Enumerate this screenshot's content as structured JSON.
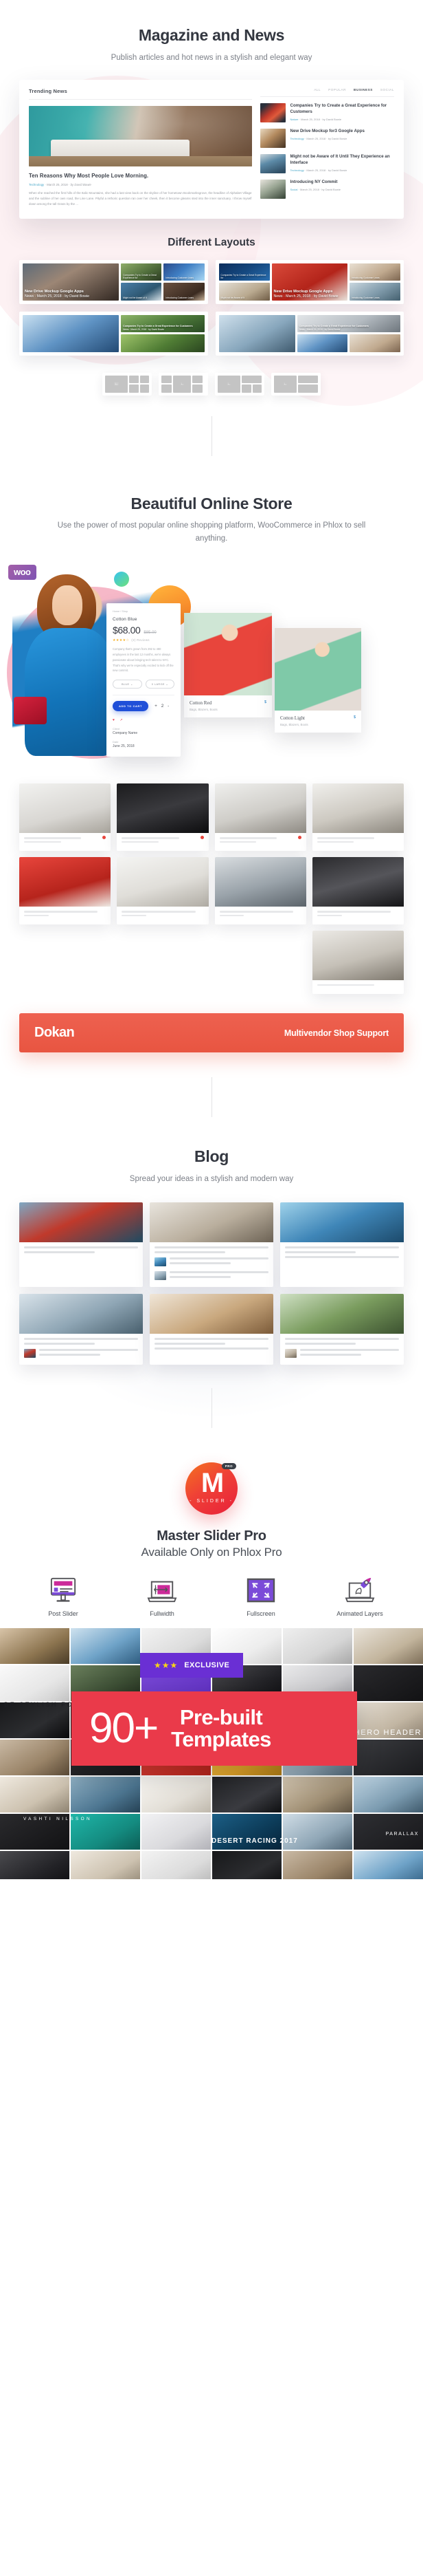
{
  "magazine": {
    "title": "Magazine and News",
    "subtitle": "Publish articles and hot news in a stylish and elegant way",
    "mockup": {
      "section_heading": "Trending News",
      "tabs": [
        "ALL",
        "POPULAR",
        "BUSINESS",
        "SOCIAL"
      ],
      "active_tab": "BUSINESS",
      "feature": {
        "title": "Ten Reasons Why Most People Love Morning.",
        "category": "Technology",
        "date": "March 25, 2018",
        "author": "by David Bowie",
        "excerpt": "When she reached the first hills of the Italic Mountains, she had a last view back on the skyline of her hometown Bookmarksgrove, the headline of Alphabet Village and the subline of her own road, the Line Lane. Pityful a rethoric question ran over her cheek, then it become gleams sted into the inner sanctuary. I throw myself down among the tall Grass by the ..."
      },
      "sidebar_items": [
        {
          "title": "Companies Try to Create a Great Experience for Customers",
          "category": "Nature",
          "date": "March 25, 2018",
          "author": "by David Bowie"
        },
        {
          "title": "New Drive Mockup for3 Google Apps",
          "category": "Technology",
          "date": "March 25, 2018",
          "author": "by David Bowie"
        },
        {
          "title": "Might not be Aware of It Until They Experience an Interface",
          "category": "Technology",
          "date": "March 25, 2018",
          "author": "by David Bowie"
        },
        {
          "title": "Introducing NY Commit",
          "category": "Social",
          "date": "March 25, 2018",
          "author": "by David Bowie"
        }
      ]
    },
    "layouts_title": "Different Layouts",
    "layout_cards": [
      {
        "main_title": "New Drive Mockup Google Apps",
        "main_meta": "News · March 25, 2018 · by David Bowie",
        "cells": [
          "Companies Try to Create a Great Experience for",
          "Introducing Customer Lears",
          "Might not be Aware of It",
          "Introducing Customer Lears"
        ]
      },
      {
        "main_title": "New Drive Mockup Google Apps",
        "main_meta": "News · March 25, 2018 · by David Bowie",
        "cells": [
          "Companies Try to Create a Great Experience for",
          "Introducing Customer Lears",
          "Might not be Aware of It",
          "Introducing Customer Lears"
        ]
      },
      {
        "main_title": "Companies Try to Create a Great Experience for Customers",
        "main_meta": "News · March 25, 2018 · by David Bowie",
        "cells": [
          "Companies Try to Create a Great Experience for",
          "Introducing Customer Lears",
          "Might not be Aware of It",
          "Introducing Customer Lears"
        ]
      },
      {
        "main_title": "Companies Try to Create a Great Experience for Customers",
        "main_meta": "News · March 25, 2018 · by David Bowie",
        "cells": [
          "Companies Try to Create a Great Experience for",
          "Introducing Customer Lears",
          "Might not be Aware of It",
          "Introducing Customer Lears"
        ]
      }
    ],
    "wireframe_count": 4
  },
  "store": {
    "title": "Beautiful Online Store",
    "subtitle": "Use the power of most popular online shopping platform, WooCommerce in Phlox to sell anything.",
    "woo_logo": "woo",
    "product": {
      "breadcrumb": "Home / Shop",
      "name": "Cotton Blue",
      "price": "$68.00",
      "old_price": "$85.00",
      "stars": "★★★★☆",
      "reviews": "(2) Reviews",
      "description": "Company that's grown from 292 to 480 employees in the last 12 months, we're always passionate about bringing tech talent to NYC. That's why we're especially excited to kick off the new commit.",
      "option_color": "BLUE",
      "option_size": "X LARGE",
      "add_to_cart": "ADD TO CART",
      "quantity": "+ 2 -",
      "client_label": "Client",
      "client_value": "Company Name",
      "date_label": "Date",
      "date_value": "June 25, 2018"
    },
    "cards": [
      {
        "name": "Cotton Red",
        "categories": "Bags, Blazers, Boots",
        "price": "$"
      },
      {
        "name": "Cotton Light",
        "categories": "Bags, Blazers, Boots",
        "price": "$"
      }
    ],
    "dokan": {
      "logo": "Dokan",
      "tagline": "Multivendor Shop Support",
      "color": "#e85541"
    }
  },
  "blog": {
    "title": "Blog",
    "subtitle": "Spread your ideas in a stylish and modern way"
  },
  "master_slider": {
    "logo_letter": "M",
    "logo_badge": "PRO",
    "logo_word": "- SLIDER -",
    "title": "Master Slider Pro",
    "subtitle": "Available Only on Phlox Pro",
    "features": [
      {
        "label": "Post Slider",
        "icon": "monitor-post-slider-icon"
      },
      {
        "label": "Fullwidth",
        "icon": "laptop-fullwidth-icon"
      },
      {
        "label": "Fullscreen",
        "icon": "fullscreen-arrows-icon"
      },
      {
        "label": "Animated Layers",
        "icon": "rocket-laptop-icon"
      }
    ],
    "exclusive": {
      "stars": "★★★",
      "label": "EXCLUSIVE",
      "color": "#6a2fd4"
    },
    "templates_banner": {
      "count": "90+",
      "line1": "Pre-built",
      "line2": "Templates",
      "color": "#ea3a4a"
    },
    "mosaic_labels": {
      "stylish": "BE STYLISH FOR AUTUMN 2017",
      "hero_header": "HERO HEADER",
      "vashti": "VASHTI NILSSON",
      "parallax": "PARALLAX",
      "desert": "DESERT RACING 2017"
    }
  }
}
